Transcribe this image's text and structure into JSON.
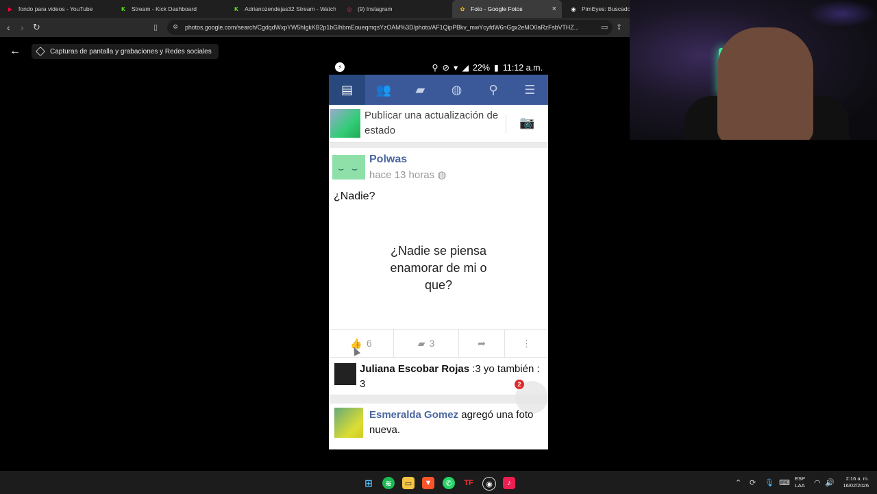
{
  "browser": {
    "tabs": [
      {
        "title": "fondo para videos - YouTube",
        "fav_color": "#ff0033",
        "fav_glyph": "▶"
      },
      {
        "title": "Stream - Kick Dashboard",
        "fav_color": "#53fc18",
        "fav_glyph": "K"
      },
      {
        "title": "Adrianozendejas32 Stream - Watch L",
        "fav_color": "#53fc18",
        "fav_glyph": "K"
      },
      {
        "title": "(9) Instagram",
        "fav_color": "#d62976",
        "fav_glyph": "◎"
      },
      {
        "title": "Foto - Google Fotos",
        "fav_color": "#fbbc04",
        "fav_glyph": "✿",
        "active": true
      },
      {
        "title": "PimEyes: Buscador d",
        "fav_color": "#ffffff",
        "fav_glyph": "◉"
      }
    ],
    "url": "photos.google.com/search/CgdqdWxpYW5hIgkKB2p1bGlhbmEoueqmqsYzOAM%3D/photo/AF1QipPBkv_mwYcyfdW6nGgx2eMO0aRzFsbVTHZ..."
  },
  "photos": {
    "album_chip": "Capturas de pantalla y grabaciones y Redes sociales"
  },
  "phone": {
    "status": {
      "battery": "22%",
      "time": "11:12 a.m."
    },
    "composer_placeholder": "Publicar una actualización de estado",
    "post": {
      "author": "Polwas",
      "time": "hace 13 horas",
      "text": "¿Nadie?",
      "image_text": "¿Nadie se piensa enamorar de mi o que?",
      "likes": "6",
      "comments": "3"
    },
    "comment": {
      "author": "Juliana Escobar Rojas",
      "text": ":3 yo también : 3",
      "badge": "2"
    },
    "next_post": {
      "author": "Esmeralda Gomez",
      "text": "agregó una foto nueva."
    }
  },
  "taskbar": {
    "lang_line1": "ESP",
    "lang_line2": "LAA",
    "time": "2:16 a. m.",
    "date": "16/02/2026"
  }
}
